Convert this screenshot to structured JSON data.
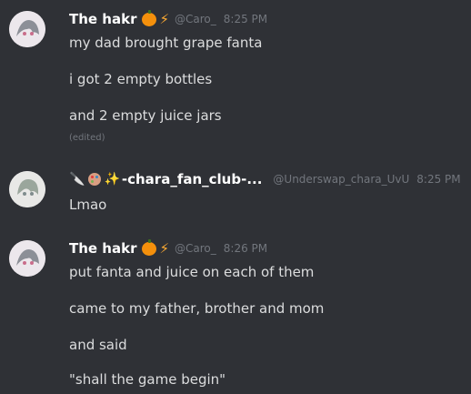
{
  "messages": [
    {
      "username": "The hakr",
      "handle": "@Caro_",
      "time": "8:25 PM",
      "lines": [
        "my dad brought grape fanta",
        "i got 2 empty bottles",
        "and 2 empty juice jars"
      ],
      "edited": "(edited)",
      "badges": [
        "pumpkin-icon",
        "lightning-icon"
      ]
    },
    {
      "username": "-chara_fan_club-...",
      "handle": "@Underswap_chara_UvU",
      "time": "8:25 PM",
      "lines": [
        "Lmao"
      ],
      "badges": [
        "knife-icon",
        "palette-icon",
        "sparkles-icon"
      ]
    },
    {
      "username": "The hakr",
      "handle": "@Caro_",
      "time": "8:26 PM",
      "lines": [
        "put fanta and juice on each of them",
        "came to my father, brother and mom",
        "and said",
        "\"shall the game begin\""
      ],
      "badges": [
        "pumpkin-icon",
        "lightning-icon"
      ]
    }
  ],
  "colors": {
    "background": "#2f3136",
    "username": "#ffffff",
    "text": "#dcddde",
    "muted": "#72767d"
  }
}
